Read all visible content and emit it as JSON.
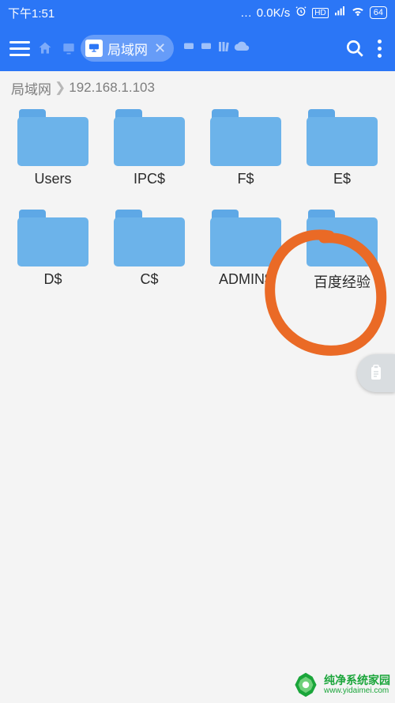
{
  "status": {
    "time": "下午1:51",
    "net_speed": "0.0K/s",
    "battery": "64"
  },
  "appbar": {
    "tab_label": "局域网"
  },
  "breadcrumb": {
    "root": "局域网",
    "path": "192.168.1.103"
  },
  "folders": {
    "0": "Users",
    "1": "IPC$",
    "2": "F$",
    "3": "E$",
    "4": "D$",
    "5": "C$",
    "6": "ADMIN$",
    "7": "百度经验"
  },
  "watermark": {
    "line1": "纯净系统家园",
    "line2": "www.yidaimei.com"
  }
}
